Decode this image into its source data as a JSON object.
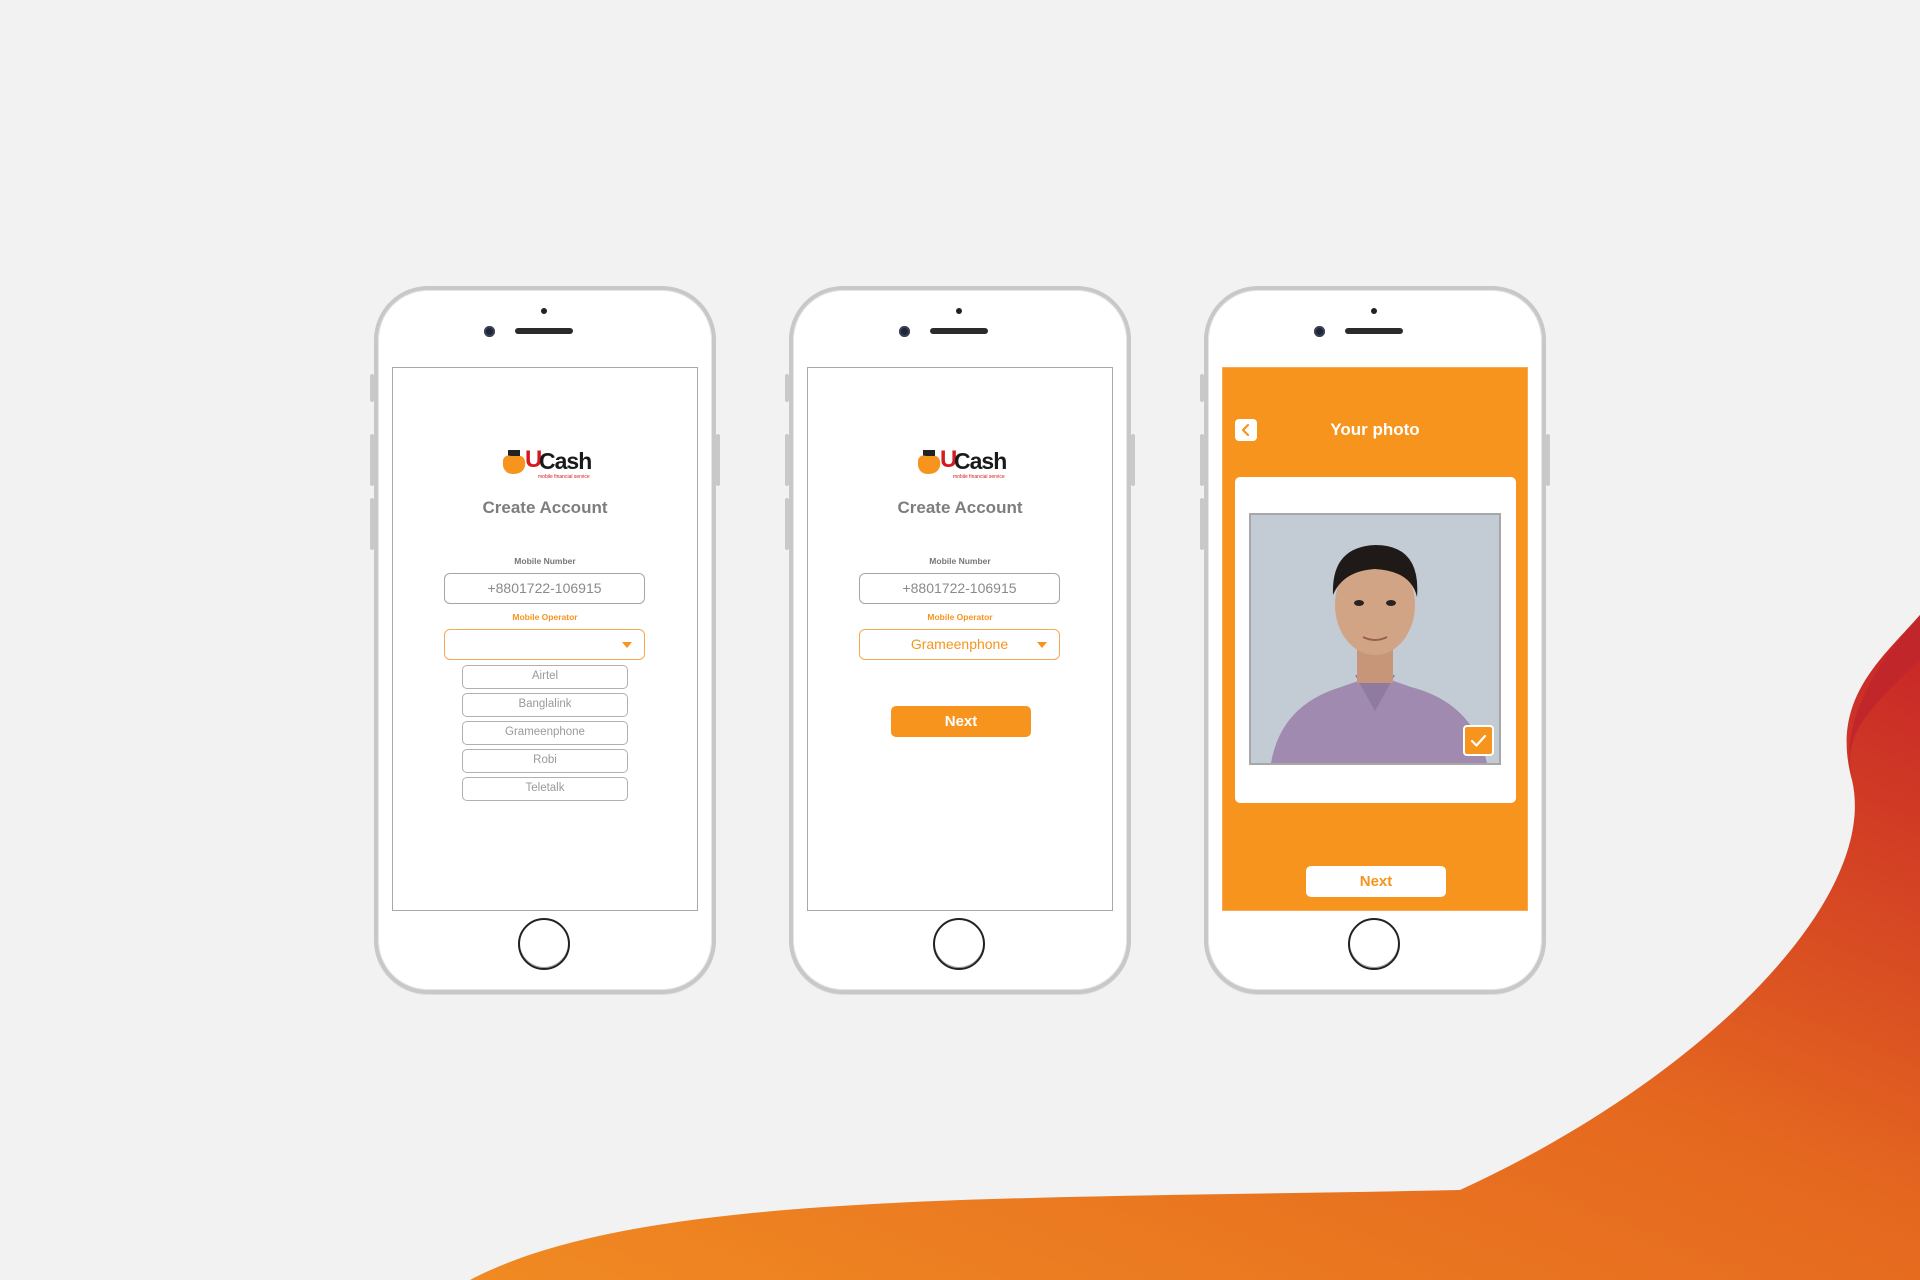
{
  "colors": {
    "brand_orange": "#f7941d",
    "brand_red": "#d71920",
    "background": "#f2f2f2"
  },
  "logo": {
    "u": "U",
    "cash": "Cash",
    "tagline": "mobile financial service"
  },
  "screen1": {
    "title": "Create Account",
    "mobile_label": "Mobile Number",
    "mobile_value": "+8801722-106915",
    "operator_label": "Mobile Operator",
    "operator_value": "",
    "operator_options": [
      "Airtel",
      "Banglalink",
      "Grameenphone",
      "Robi",
      "Teletalk"
    ]
  },
  "screen2": {
    "title": "Create Account",
    "mobile_label": "Mobile Number",
    "mobile_value": "+8801722-106915",
    "operator_label": "Mobile Operator",
    "operator_value": "Grameenphone",
    "next_label": "Next"
  },
  "screen3": {
    "title": "Your photo",
    "next_label": "Next",
    "icons": [
      "back-arrow-icon",
      "checkmark-icon"
    ]
  }
}
